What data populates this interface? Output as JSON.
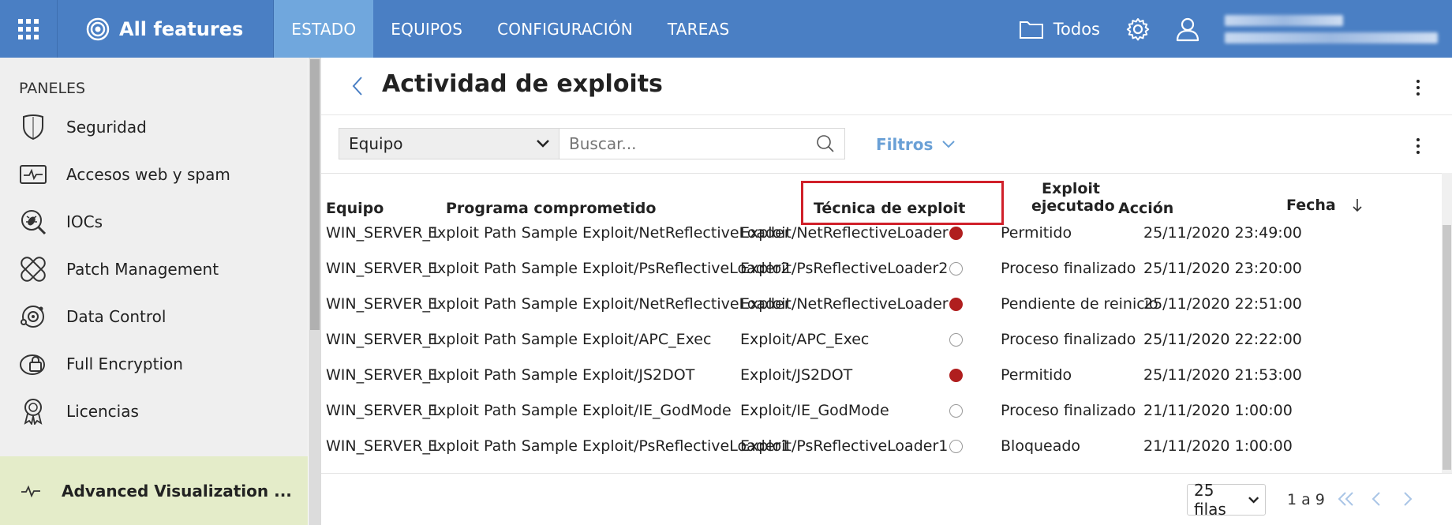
{
  "topbar": {
    "brand": "All features",
    "tabs": [
      {
        "label": "ESTADO",
        "active": true
      },
      {
        "label": "EQUIPOS",
        "active": false
      },
      {
        "label": "CONFIGURACIÓN",
        "active": false
      },
      {
        "label": "TAREAS",
        "active": false
      }
    ],
    "folder_label": "Todos",
    "icons": [
      "apps-grid-icon",
      "target-icon",
      "folder-icon",
      "gear-icon",
      "user-icon"
    ]
  },
  "sidebar": {
    "title": "PANELES",
    "items": [
      {
        "label": "Seguridad",
        "icon": "shield-icon"
      },
      {
        "label": "Accesos web y spam",
        "icon": "monitor-pulse-icon"
      },
      {
        "label": "IOCs",
        "icon": "magnifier-bug-icon"
      },
      {
        "label": "Patch Management",
        "icon": "bandage-icon"
      },
      {
        "label": "Data Control",
        "icon": "data-orbit-icon"
      },
      {
        "label": "Full Encryption",
        "icon": "disk-lock-icon"
      },
      {
        "label": "Licencias",
        "icon": "award-icon"
      }
    ],
    "advanced": {
      "label": "Advanced Visualization ...",
      "icon": "pulse-icon"
    }
  },
  "page": {
    "title": "Actividad de exploits"
  },
  "filters": {
    "select_value": "Equipo",
    "search_placeholder": "Buscar...",
    "filters_label": "Filtros"
  },
  "table": {
    "headers": {
      "equipo": "Equipo",
      "programa": "Programa comprometido",
      "tecnica": "Técnica de exploit",
      "ejecutado_1": "Exploit",
      "ejecutado_2": "ejecutado",
      "accion": "Acción",
      "fecha": "Fecha"
    },
    "rows": [
      {
        "equipo": "WIN_SERVER_1",
        "programa": "Exploit Path Sample Exploit/NetReflectiveLoader",
        "tecnica": "Exploit/NetReflectiveLoader",
        "ejecutado": true,
        "accion": "Permitido",
        "fecha": "25/11/2020 23:49:00"
      },
      {
        "equipo": "WIN_SERVER_1",
        "programa": "Exploit Path Sample Exploit/PsReflectiveLoader2",
        "tecnica": "Exploit/PsReflectiveLoader2",
        "ejecutado": false,
        "accion": "Proceso finalizado",
        "fecha": "25/11/2020 23:20:00"
      },
      {
        "equipo": "WIN_SERVER_1",
        "programa": "Exploit Path Sample Exploit/NetReflectiveLoader",
        "tecnica": "Exploit/NetReflectiveLoader",
        "ejecutado": true,
        "accion": "Pendiente de reinicio",
        "fecha": "25/11/2020 22:51:00"
      },
      {
        "equipo": "WIN_SERVER_1",
        "programa": "Exploit Path Sample Exploit/APC_Exec",
        "tecnica": "Exploit/APC_Exec",
        "ejecutado": false,
        "accion": "Proceso finalizado",
        "fecha": "25/11/2020 22:22:00"
      },
      {
        "equipo": "WIN_SERVER_1",
        "programa": "Exploit Path Sample Exploit/JS2DOT",
        "tecnica": "Exploit/JS2DOT",
        "ejecutado": true,
        "accion": "Permitido",
        "fecha": "25/11/2020 21:53:00"
      },
      {
        "equipo": "WIN_SERVER_1",
        "programa": "Exploit Path Sample Exploit/IE_GodMode",
        "tecnica": "Exploit/IE_GodMode",
        "ejecutado": false,
        "accion": "Proceso finalizado",
        "fecha": "21/11/2020 1:00:00"
      },
      {
        "equipo": "WIN_SERVER_1",
        "programa": "Exploit Path Sample Exploit/PsReflectiveLoader1",
        "tecnica": "Exploit/PsReflectiveLoader1",
        "ejecutado": false,
        "accion": "Bloqueado",
        "fecha": "21/11/2020 1:00:00"
      }
    ]
  },
  "footer": {
    "rows_per_page": "25 filas",
    "range": "1 a 9"
  },
  "colors": {
    "topbar": "#4a7fc4",
    "active_tab": "#70a7dd",
    "accent_link": "#6aa0d6",
    "dot_executed": "#b01e1e",
    "highlight_box": "#d0202a",
    "advanced_bg": "#e4ecc9"
  }
}
